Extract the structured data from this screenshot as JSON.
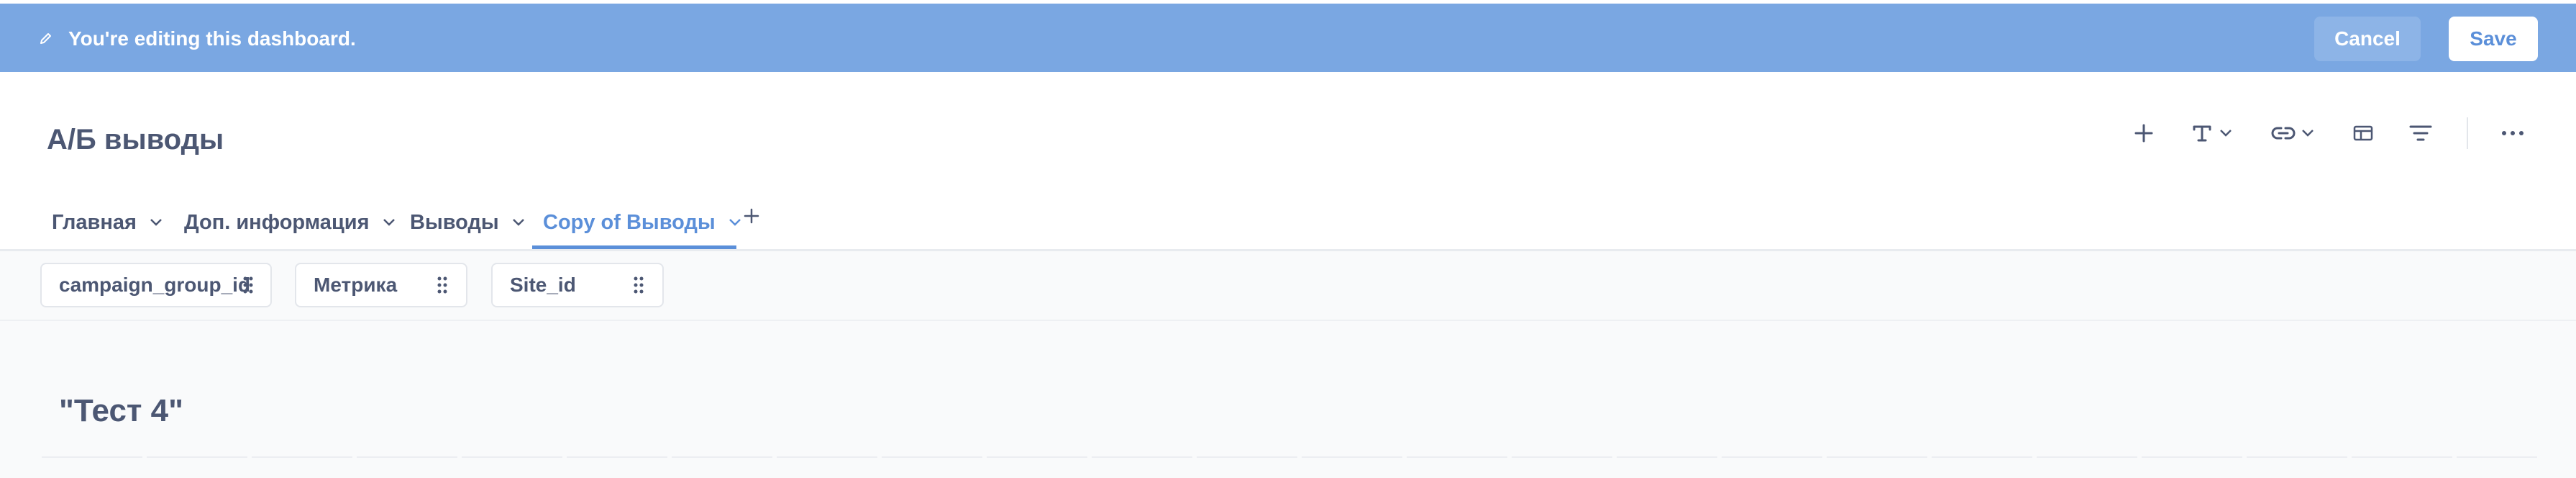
{
  "banner": {
    "message": "You're editing this dashboard.",
    "cancel_label": "Cancel",
    "save_label": "Save"
  },
  "dashboard": {
    "title": "А/Б выводы"
  },
  "toolbar": {
    "icons": [
      "add-icon",
      "text-icon",
      "link-icon",
      "section-icon",
      "filter-icon",
      "more-icon"
    ]
  },
  "tabs": [
    {
      "label": "Главная",
      "active": false
    },
    {
      "label": "Доп. информация",
      "active": false
    },
    {
      "label": "Выводы",
      "active": false
    },
    {
      "label": "Copy of Выводы",
      "active": true
    }
  ],
  "filters": [
    {
      "label": "campaign_group_id"
    },
    {
      "label": "Метрика"
    },
    {
      "label": "Site_id"
    }
  ],
  "cards": [
    {
      "title": "\"Тест 4\""
    }
  ],
  "colors": {
    "banner_bg": "#7aa7e2",
    "accent": "#5b8fd9",
    "text": "#4c5773"
  }
}
